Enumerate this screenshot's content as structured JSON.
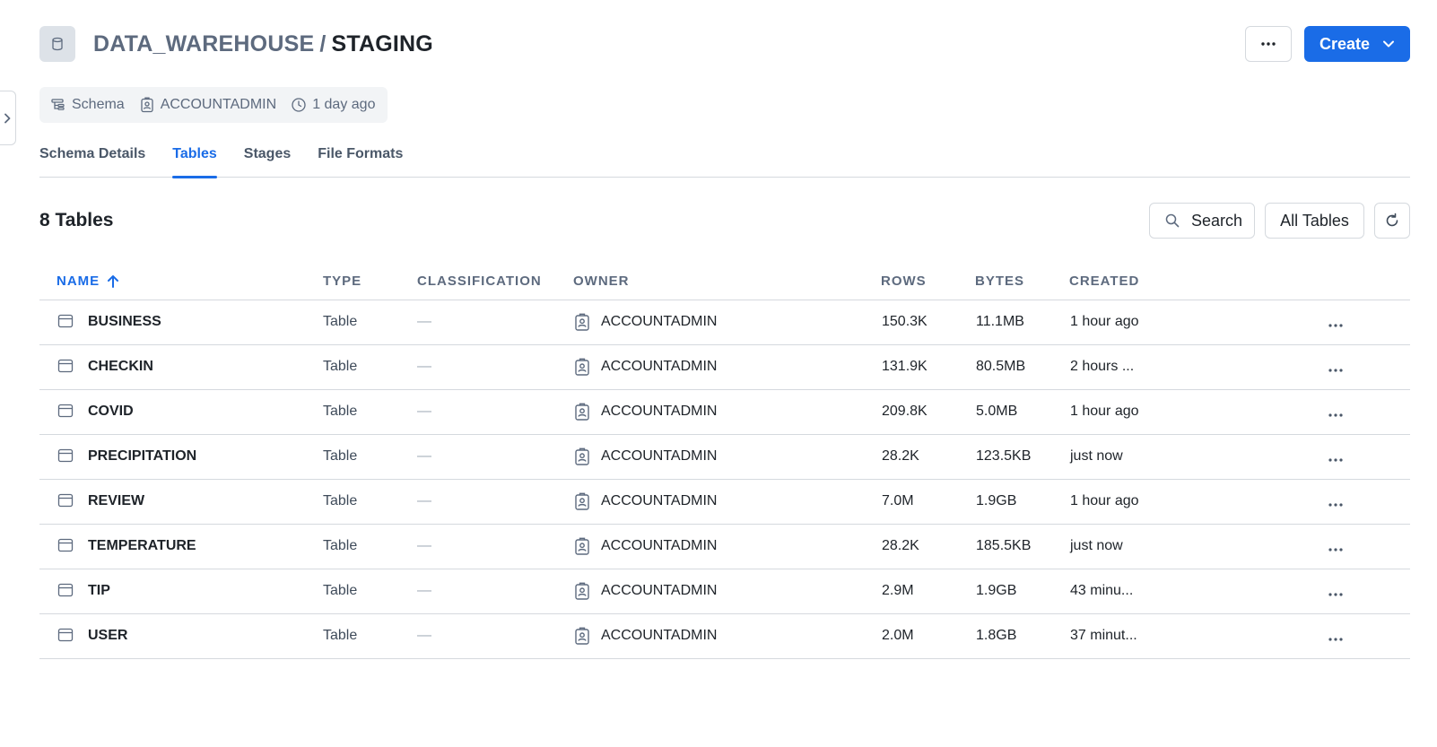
{
  "header": {
    "database": "DATA_WAREHOUSE",
    "separator": "/",
    "schema": "STAGING",
    "create_label": "Create"
  },
  "meta": {
    "type_label": "Schema",
    "owner": "ACCOUNTADMIN",
    "updated": "1 day ago"
  },
  "tabs": [
    {
      "label": "Schema Details"
    },
    {
      "label": "Tables"
    },
    {
      "label": "Stages"
    },
    {
      "label": "File Formats"
    }
  ],
  "active_tab": "Tables",
  "list": {
    "count_label": "8 Tables",
    "search_label": "Search",
    "filter_label": "All Tables"
  },
  "columns": {
    "name": "NAME",
    "type": "TYPE",
    "classification": "CLASSIFICATION",
    "owner": "OWNER",
    "rows": "ROWS",
    "bytes": "BYTES",
    "created": "CREATED"
  },
  "rows": [
    {
      "name": "BUSINESS",
      "type": "Table",
      "classification": "—",
      "owner": "ACCOUNTADMIN",
      "rows": "150.3K",
      "bytes": "11.1MB",
      "created": "1 hour ago"
    },
    {
      "name": "CHECKIN",
      "type": "Table",
      "classification": "—",
      "owner": "ACCOUNTADMIN",
      "rows": "131.9K",
      "bytes": "80.5MB",
      "created": "2 hours ..."
    },
    {
      "name": "COVID",
      "type": "Table",
      "classification": "—",
      "owner": "ACCOUNTADMIN",
      "rows": "209.8K",
      "bytes": "5.0MB",
      "created": "1 hour ago"
    },
    {
      "name": "PRECIPITATION",
      "type": "Table",
      "classification": "—",
      "owner": "ACCOUNTADMIN",
      "rows": "28.2K",
      "bytes": "123.5KB",
      "created": "just now"
    },
    {
      "name": "REVIEW",
      "type": "Table",
      "classification": "—",
      "owner": "ACCOUNTADMIN",
      "rows": "7.0M",
      "bytes": "1.9GB",
      "created": "1 hour ago"
    },
    {
      "name": "TEMPERATURE",
      "type": "Table",
      "classification": "—",
      "owner": "ACCOUNTADMIN",
      "rows": "28.2K",
      "bytes": "185.5KB",
      "created": "just now"
    },
    {
      "name": "TIP",
      "type": "Table",
      "classification": "—",
      "owner": "ACCOUNTADMIN",
      "rows": "2.9M",
      "bytes": "1.9GB",
      "created": "43 minu..."
    },
    {
      "name": "USER",
      "type": "Table",
      "classification": "—",
      "owner": "ACCOUNTADMIN",
      "rows": "2.0M",
      "bytes": "1.8GB",
      "created": "37 minut..."
    }
  ],
  "colors": {
    "accent": "#1a6ce7",
    "muted_text": "#5d6a7e",
    "border": "#d5d9de"
  }
}
